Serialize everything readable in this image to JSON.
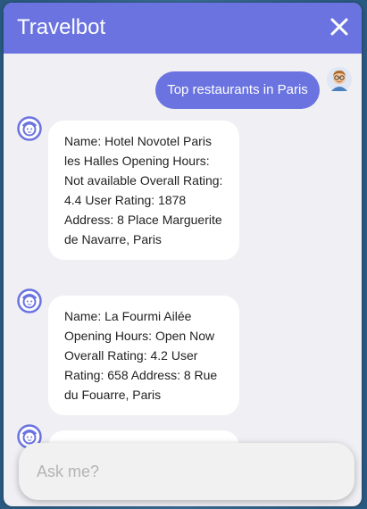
{
  "header": {
    "title": "Travelbot",
    "accent_color": "#6a73e0"
  },
  "messages": [
    {
      "from": "user",
      "text": "Top restaurants in Paris",
      "avatar_icon": "user-avatar-icon"
    },
    {
      "from": "bot",
      "text": "Name: Hotel Novotel Paris les Halles Opening Hours: Not available Overall Rating: 4.4 User Rating: 1878 Address: 8 Place Marguerite de Navarre, Paris",
      "avatar_icon": "bot-avatar-icon"
    },
    {
      "from": "bot",
      "text": "Name: La Fourmi Ailée Opening Hours: Open Now Overall Rating: 4.2 User Rating: 658 Address: 8 Rue du Fouarre, Paris",
      "avatar_icon": "bot-avatar-icon"
    },
    {
      "from": "bot",
      "text": "",
      "avatar_icon": "bot-avatar-icon"
    }
  ],
  "input": {
    "placeholder": "Ask me?",
    "value": ""
  }
}
